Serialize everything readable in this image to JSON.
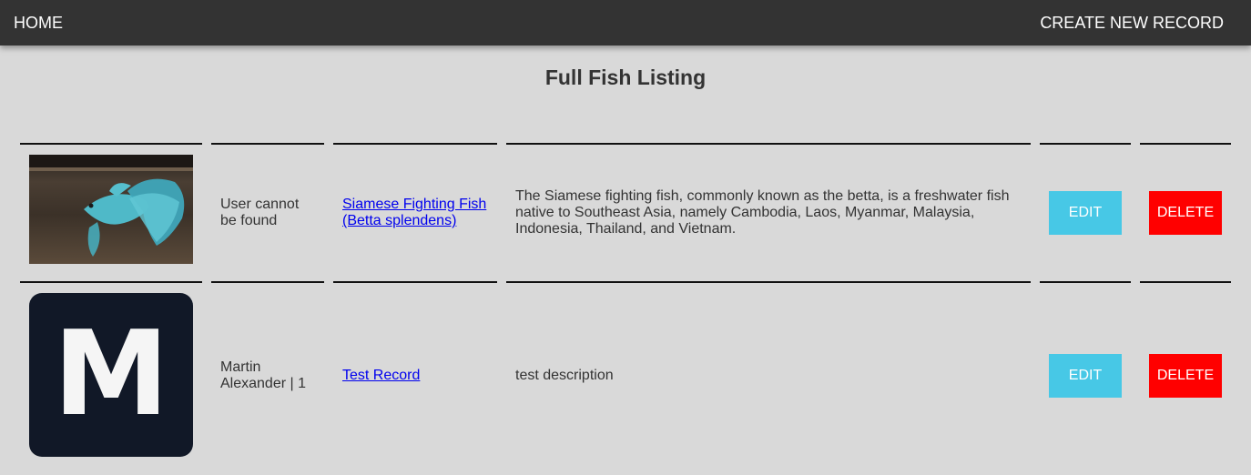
{
  "nav": {
    "home_label": "HOME",
    "create_label": "CREATE NEW RECORD"
  },
  "page": {
    "title": "Full Fish Listing"
  },
  "records": [
    {
      "image": "betta-fish-photo",
      "user": "User cannot be found",
      "name": "Siamese Fighting Fish (Betta splendens)",
      "description": "The Siamese fighting fish, commonly known as the betta, is a freshwater fish native to Southeast Asia, namely Cambodia, Laos, Myanmar, Malaysia, Indonesia, Thailand, and Vietnam.",
      "edit_label": "EDIT",
      "delete_label": "DELETE"
    },
    {
      "image": "letter-avatar",
      "avatar_letter": "M",
      "user": "Martin Alexander | 1",
      "name": "Test Record",
      "description": "test description",
      "edit_label": "EDIT",
      "delete_label": "DELETE"
    }
  ],
  "colors": {
    "navbar": "#333333",
    "background": "#d9d9d9",
    "edit_button": "#47c8e6",
    "delete_button": "#ff0000",
    "link": "#0000ee",
    "avatar_bg": "#111827"
  }
}
